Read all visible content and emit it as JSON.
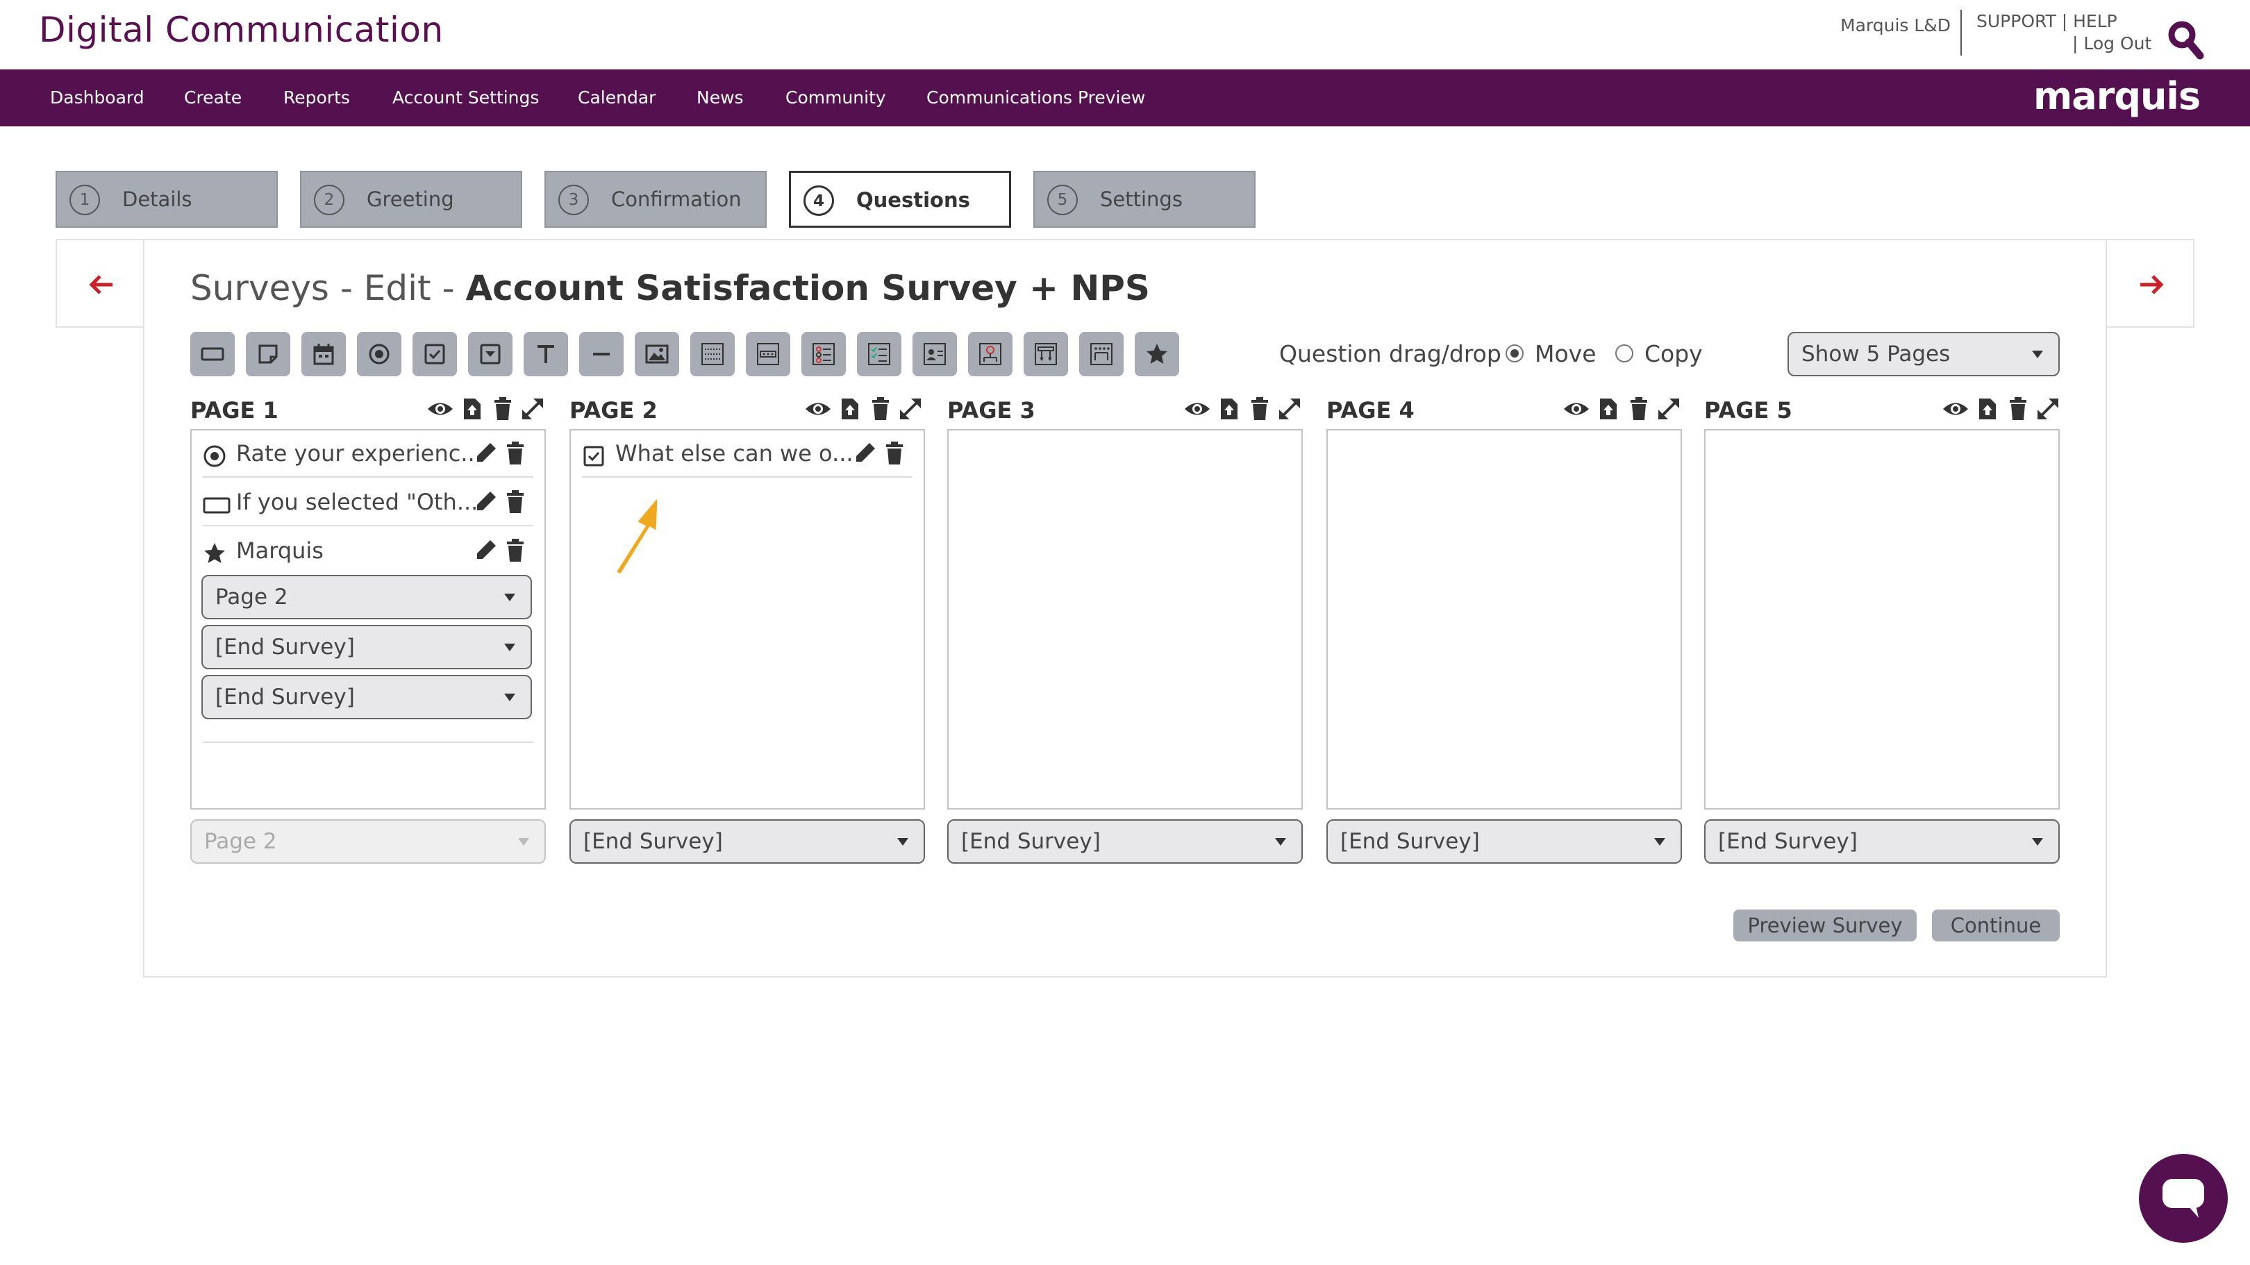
{
  "header": {
    "brand": "Digital Communication",
    "user": "Marquis L&D",
    "support": "SUPPORT | HELP",
    "logout": "| Log Out"
  },
  "nav": {
    "items": [
      "Dashboard",
      "Create",
      "Reports",
      "Account Settings",
      "Calendar",
      "News",
      "Community",
      "Communications Preview"
    ],
    "logo": "marquis"
  },
  "steps": [
    {
      "num": "1",
      "label": "Details",
      "active": false
    },
    {
      "num": "2",
      "label": "Greeting",
      "active": false
    },
    {
      "num": "3",
      "label": "Confirmation",
      "active": false
    },
    {
      "num": "4",
      "label": "Questions",
      "active": true
    },
    {
      "num": "5",
      "label": "Settings",
      "active": false
    }
  ],
  "title": {
    "prefix": "Surveys - Edit - ",
    "name": "Account Satisfaction Survey + NPS"
  },
  "toolbar": {
    "tools": [
      "text-box-icon",
      "note-icon",
      "calendar-icon",
      "radio-icon",
      "checkbox-icon",
      "dropdown-icon",
      "text-icon",
      "divider-icon",
      "image-icon",
      "grid-icon",
      "dots-grid-icon",
      "matrix-radio-icon",
      "matrix-check-icon",
      "contact-icon",
      "address-icon",
      "ranking-icon",
      "dots-layout-icon",
      "star-icon"
    ],
    "drag_label": "Question drag/drop",
    "move_label": "Move",
    "copy_label": "Copy",
    "move_selected": true,
    "show_pages": "Show 5 Pages"
  },
  "pages": [
    {
      "title": "PAGE 1",
      "questions": [
        {
          "icon": "radio-icon",
          "text": "Rate your experienc..."
        },
        {
          "icon": "text-box-icon",
          "text": "If you selected \"Oth..."
        },
        {
          "icon": "star-icon",
          "text": "Marquis"
        }
      ],
      "branch_selects": [
        "Page 2",
        "[End Survey]",
        "[End Survey]"
      ],
      "next": "Page 2",
      "next_disabled": true
    },
    {
      "title": "PAGE 2",
      "questions": [
        {
          "icon": "checkbox-icon",
          "text": "What else can we o..."
        }
      ],
      "next": "[End Survey]",
      "next_disabled": false
    },
    {
      "title": "PAGE 3",
      "questions": [],
      "next": "[End Survey]",
      "next_disabled": false
    },
    {
      "title": "PAGE 4",
      "questions": [],
      "next": "[End Survey]",
      "next_disabled": false
    },
    {
      "title": "PAGE 5",
      "questions": [],
      "next": "[End Survey]",
      "next_disabled": false
    }
  ],
  "actions": {
    "preview": "Preview Survey",
    "continue": "Continue"
  },
  "colors": {
    "brand": "#551050",
    "accent_arrow": "#cc1f26",
    "tool_gray": "#a7abb3",
    "pointer": "#f0a81c"
  }
}
